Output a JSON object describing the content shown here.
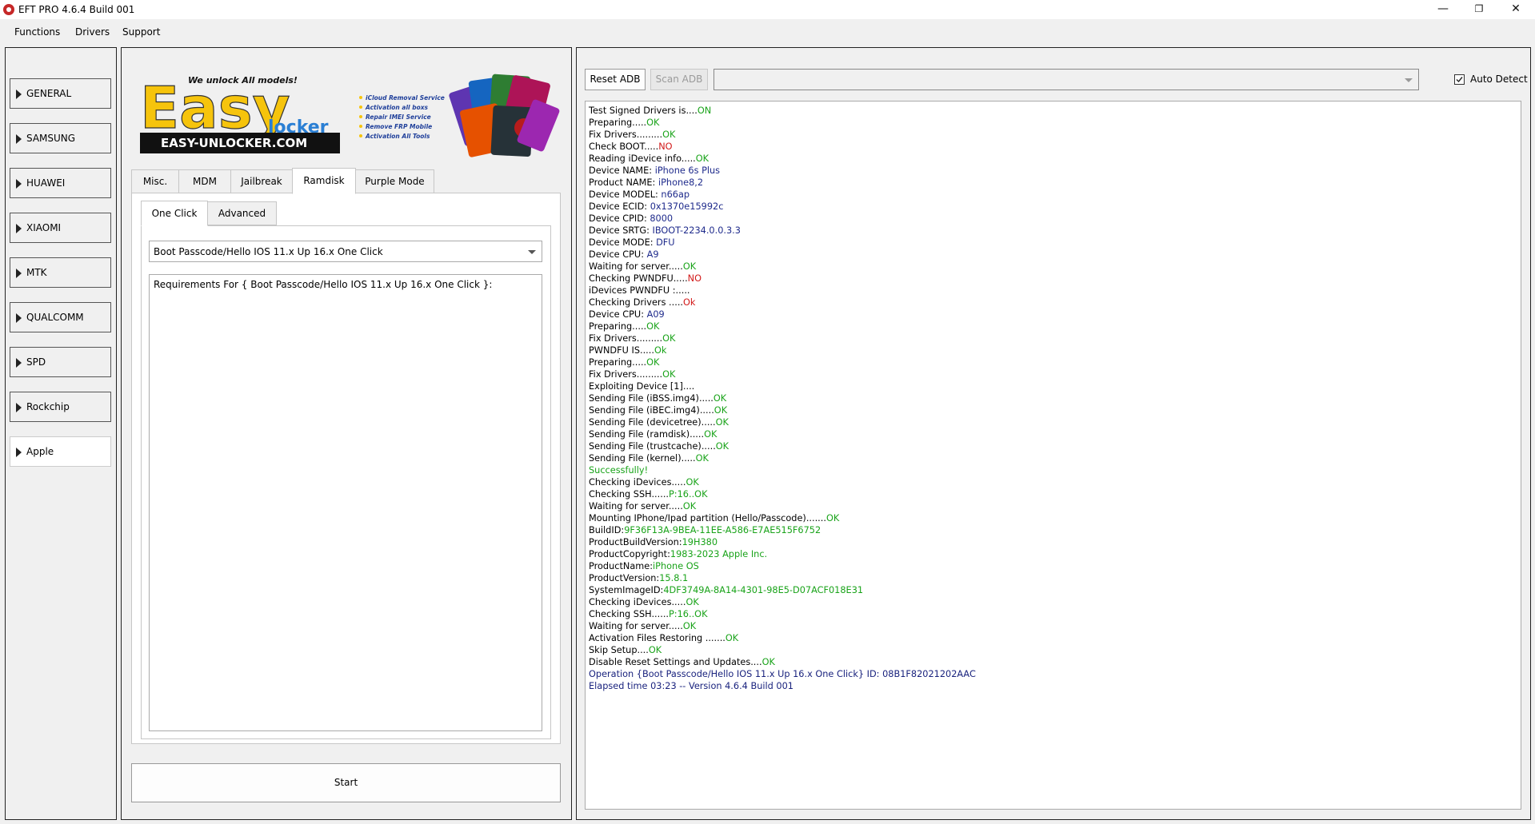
{
  "window": {
    "title": "EFT PRO 4.6.4 Build 001",
    "minimize_glyph": "—",
    "maximize_glyph": "❐",
    "close_glyph": "✕"
  },
  "menu": [
    "Functions",
    "Drivers",
    "Support"
  ],
  "brands": [
    "GENERAL",
    "SAMSUNG",
    "HUAWEI",
    "XIAOMI",
    "MTK",
    "QUALCOMM",
    "SPD",
    "Rockchip",
    "Apple"
  ],
  "banner": {
    "tagline": "We unlock All models!",
    "logo_top": "Easy",
    "logo_bottom": "locker",
    "url": "EASY-UNLOCKER.COM",
    "services": [
      "iCloud Removal Service",
      "Activation all boxs",
      "Repair IMEI Service",
      "Remove FRP Mobile",
      "Activation All Tools"
    ]
  },
  "tabs": [
    "Misc.",
    "MDM",
    "Jailbreak",
    "Ramdisk",
    "Purple Mode"
  ],
  "subtabs": [
    "One Click",
    "Advanced"
  ],
  "operation_select": "Boot Passcode/Hello IOS 11.x Up 16.x One Click",
  "requirements_text": "Requirements For { Boot Passcode/Hello IOS 11.x Up 16.x One Click }:",
  "start_label": "Start",
  "adb": {
    "reset": "Reset ADB",
    "scan": "Scan ADB",
    "device_value": "",
    "auto_detect": "Auto Detect"
  },
  "log": [
    {
      "t": "Test Signed Drivers is....",
      "s": "ON",
      "c": "ok"
    },
    {
      "t": "Preparing.....",
      "s": "OK",
      "c": "ok"
    },
    {
      "t": "Fix Drivers.........",
      "s": "OK",
      "c": "ok"
    },
    {
      "t": "Check BOOT.....",
      "s": "NO",
      "c": "no"
    },
    {
      "t": "Reading iDevice info.....",
      "s": "OK",
      "c": "ok"
    },
    {
      "t": "Device NAME: ",
      "s": "iPhone 6s Plus",
      "c": "info"
    },
    {
      "t": "Product NAME: ",
      "s": "iPhone8,2",
      "c": "info"
    },
    {
      "t": "Device MODEL: ",
      "s": "n66ap",
      "c": "info"
    },
    {
      "t": "Device ECID: ",
      "s": "0x1370e15992c",
      "c": "info"
    },
    {
      "t": "Device CPID: ",
      "s": "8000",
      "c": "info"
    },
    {
      "t": "Device SRTG: ",
      "s": "IBOOT-2234.0.0.3.3",
      "c": "info"
    },
    {
      "t": "Device MODE: ",
      "s": "DFU",
      "c": "info"
    },
    {
      "t": "Device CPU: ",
      "s": "A9",
      "c": "info"
    },
    {
      "t": "Waiting for server.....",
      "s": "OK",
      "c": "ok"
    },
    {
      "t": "Checking PWNDFU.....",
      "s": "NO",
      "c": "no"
    },
    {
      "t": "iDevices PWNDFU :.....",
      "s": "",
      "c": "ok"
    },
    {
      "t": "Checking Drivers .....",
      "s": "Ok",
      "c": "no"
    },
    {
      "t": "Device CPU: ",
      "s": "A09",
      "c": "info"
    },
    {
      "t": "Preparing.....",
      "s": "OK",
      "c": "ok"
    },
    {
      "t": "Fix Drivers.........",
      "s": "OK",
      "c": "ok"
    },
    {
      "t": "PWNDFU IS.....",
      "s": "Ok",
      "c": "ok"
    },
    {
      "t": "Preparing.....",
      "s": "OK",
      "c": "ok"
    },
    {
      "t": "Fix Drivers.........",
      "s": "OK",
      "c": "ok"
    },
    {
      "t": "Exploiting Device [1]....",
      "s": "",
      "c": "ok"
    },
    {
      "t": "Sending File (iBSS.img4).....",
      "s": "OK",
      "c": "ok"
    },
    {
      "t": "Sending File (iBEC.img4).....",
      "s": "OK",
      "c": "ok"
    },
    {
      "t": "Sending File (devicetree).....",
      "s": "OK",
      "c": "ok"
    },
    {
      "t": "Sending File (ramdisk).....",
      "s": "OK",
      "c": "ok"
    },
    {
      "t": "Sending File (trustcache).....",
      "s": "OK",
      "c": "ok"
    },
    {
      "t": "Sending File (kernel).....",
      "s": "OK",
      "c": "ok"
    },
    {
      "t": "",
      "s": "Successfully!",
      "c": "ok"
    },
    {
      "t": "Checking iDevices.....",
      "s": "OK",
      "c": "ok"
    },
    {
      "t": "Checking SSH......",
      "s": "P:16..OK",
      "c": "ok"
    },
    {
      "t": "Waiting for server.....",
      "s": "OK",
      "c": "ok"
    },
    {
      "t": "Mounting IPhone/Ipad partition (Hello/Passcode).......",
      "s": "OK",
      "c": "ok"
    },
    {
      "t": "BuildID:",
      "s": "9F36F13A-9BEA-11EE-A586-E7AE515F6752",
      "c": "ok"
    },
    {
      "t": "ProductBuildVersion:",
      "s": "19H380",
      "c": "ok"
    },
    {
      "t": "ProductCopyright:",
      "s": "1983-2023 Apple Inc.",
      "c": "ok"
    },
    {
      "t": "ProductName:",
      "s": "iPhone OS",
      "c": "ok"
    },
    {
      "t": "ProductVersion:",
      "s": "15.8.1",
      "c": "ok"
    },
    {
      "t": "SystemImageID:",
      "s": "4DF3749A-8A14-4301-98E5-D07ACF018E31",
      "c": "ok"
    },
    {
      "t": "Checking iDevices.....",
      "s": "OK",
      "c": "ok"
    },
    {
      "t": "Checking SSH......",
      "s": "P:16..OK",
      "c": "ok"
    },
    {
      "t": "Waiting for server.....",
      "s": "OK",
      "c": "ok"
    },
    {
      "t": "Activation Files Restoring .......",
      "s": "OK",
      "c": "ok"
    },
    {
      "t": "Skip Setup....",
      "s": "OK",
      "c": "ok"
    },
    {
      "t": "Disable Reset Settings and Updates....",
      "s": "OK",
      "c": "ok"
    },
    {
      "t": "",
      "s": "Operation {Boot Passcode/Hello IOS 11.x Up 16.x One Click} ID: 08B1F82021202AAC",
      "c": "navy"
    },
    {
      "t": "",
      "s": "Elapsed time 03:23 -- Version 4.6.4 Build 001",
      "c": "navy"
    }
  ],
  "colors": {
    "ok": "#19a319",
    "no": "#d21919",
    "info": "#1f2b8c",
    "navy": "#1a237e"
  }
}
